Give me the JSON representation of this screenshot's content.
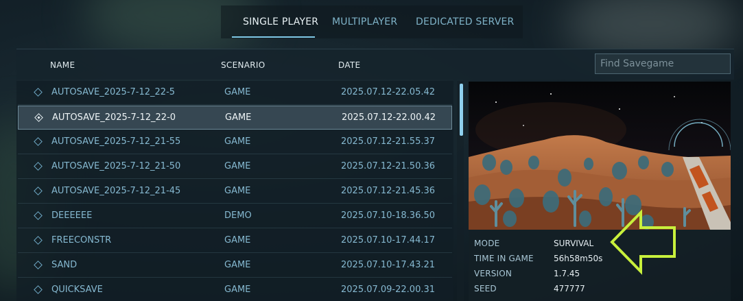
{
  "tabs": [
    {
      "label": "SINGLE PLAYER",
      "active": true
    },
    {
      "label": "MULTIPLAYER",
      "active": false
    },
    {
      "label": "DEDICATED SERVER",
      "active": false
    }
  ],
  "columns": {
    "name": "NAME",
    "scenario": "SCENARIO",
    "date": "DATE"
  },
  "search": {
    "placeholder": "Find Savegame",
    "value": ""
  },
  "rows": [
    {
      "name": "AUTOSAVE_2025-7-12_22-5",
      "scenario": "GAME",
      "date": "2025.07.12-22.05.42",
      "selected": false
    },
    {
      "name": "AUTOSAVE_2025-7-12_22-0",
      "scenario": "GAME",
      "date": "2025.07.12-22.00.42",
      "selected": true
    },
    {
      "name": "AUTOSAVE_2025-7-12_21-55",
      "scenario": "GAME",
      "date": "2025.07.12-21.55.37",
      "selected": false
    },
    {
      "name": "AUTOSAVE_2025-7-12_21-50",
      "scenario": "GAME",
      "date": "2025.07.12-21.50.36",
      "selected": false
    },
    {
      "name": "AUTOSAVE_2025-7-12_21-45",
      "scenario": "GAME",
      "date": "2025.07.12-21.45.36",
      "selected": false
    },
    {
      "name": "DEEEEEE",
      "scenario": "DEMO",
      "date": "2025.07.10-18.36.50",
      "selected": false
    },
    {
      "name": "FREECONSTR",
      "scenario": "GAME",
      "date": "2025.07.10-17.44.17",
      "selected": false
    },
    {
      "name": "SAND",
      "scenario": "GAME",
      "date": "2025.07.10-17.43.21",
      "selected": false
    },
    {
      "name": "QUICKSAVE",
      "scenario": "GAME",
      "date": "2025.07.09-22.00.31",
      "selected": false
    }
  ],
  "details": [
    {
      "label": "MODE",
      "value": "SURVIVAL"
    },
    {
      "label": "TIME IN GAME",
      "value": "56h58m50s"
    },
    {
      "label": "VERSION",
      "value": "1.7.45"
    },
    {
      "label": "SEED",
      "value": "477777"
    }
  ],
  "colors": {
    "accent": "#7fc8e6",
    "arrow": "#c8f03c",
    "row_text": "#86b9d1"
  },
  "icons": {
    "row_marker": "diamond-icon",
    "annotation": "arrow-left-icon"
  }
}
